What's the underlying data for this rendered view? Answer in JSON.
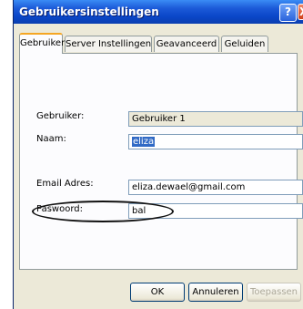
{
  "window": {
    "title": "Gebruikersinstellingen",
    "help_label": "?",
    "close_label": "X",
    "accent_color": "#0a46c8"
  },
  "tabs": [
    {
      "label": "Gebruiker",
      "active": true
    },
    {
      "label": "Server Instellingen",
      "active": false
    },
    {
      "label": "Geavanceerd",
      "active": false
    },
    {
      "label": "Geluiden",
      "active": false
    }
  ],
  "form": {
    "gebruiker": {
      "label": "Gebruiker:",
      "value": "Gebruiker 1"
    },
    "naam": {
      "label": "Naam:",
      "value": "eliza"
    },
    "email": {
      "label": "Email Adres:",
      "value": "eliza.dewael@gmail.com"
    },
    "paswoord": {
      "label": "Paswoord:",
      "value": "bal"
    }
  },
  "buttons": {
    "ok": "OK",
    "cancel": "Annuleren",
    "apply": "Toepassen"
  }
}
